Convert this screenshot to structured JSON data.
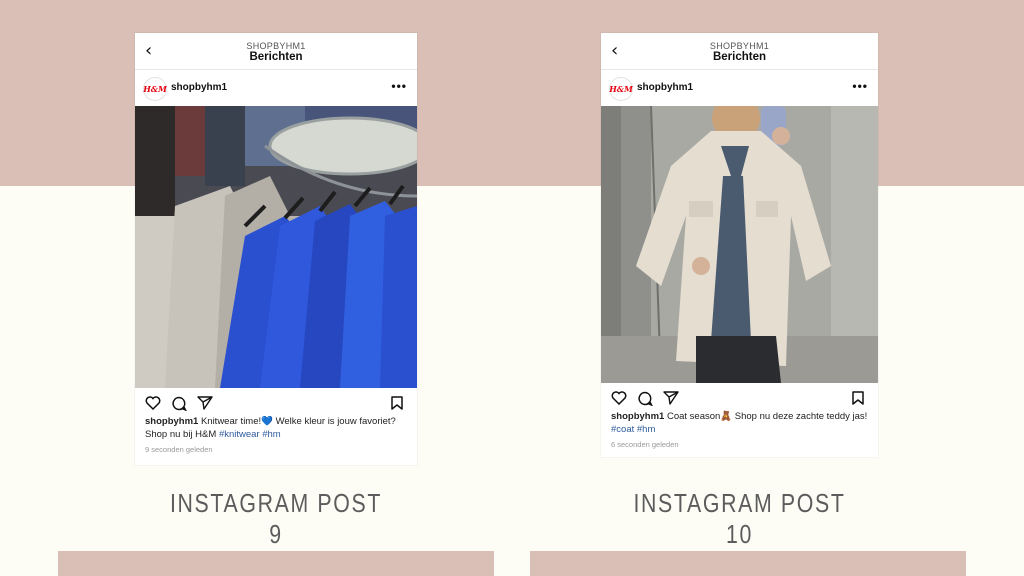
{
  "posts": [
    {
      "header_account": "SHOPBYHM1",
      "header_title": "Berichten",
      "avatar_text": "H&M",
      "username": "shopbyhm1",
      "caption_user": "shopbyhm1",
      "caption_text": " Knitwear time!💙 Welke kleur is jouw favoriet? Shop nu bij H&M ",
      "hashtags": "#knitwear #hm",
      "time_ago": "9 seconden geleden",
      "label": "INSTAGRAM POST 9",
      "photo_subject": "blue and grey knit sweaters on rack"
    },
    {
      "header_account": "SHOPBYHM1",
      "header_title": "Berichten",
      "avatar_text": "H&M",
      "username": "shopbyhm1",
      "caption_user": "shopbyhm1",
      "caption_text": " Coat season🧸 Shop nu deze zachte teddy jas! ",
      "hashtags": "#coat #hm",
      "time_ago": "6 seconden geleden",
      "label": "INSTAGRAM POST 10",
      "photo_subject": "woman in teddy jacket mirror selfie"
    }
  ],
  "icons": {
    "back": "chevron-left",
    "more": "ellipsis",
    "like": "heart",
    "comment": "speech-bubble",
    "share": "paper-plane",
    "save": "bookmark"
  },
  "colors": {
    "band": "#d9bfb6",
    "background": "#fdfdf6",
    "label_text": "#5c5c5c",
    "hashtag": "#2f5a9c",
    "sweater_blue": "#2a4fcf"
  }
}
